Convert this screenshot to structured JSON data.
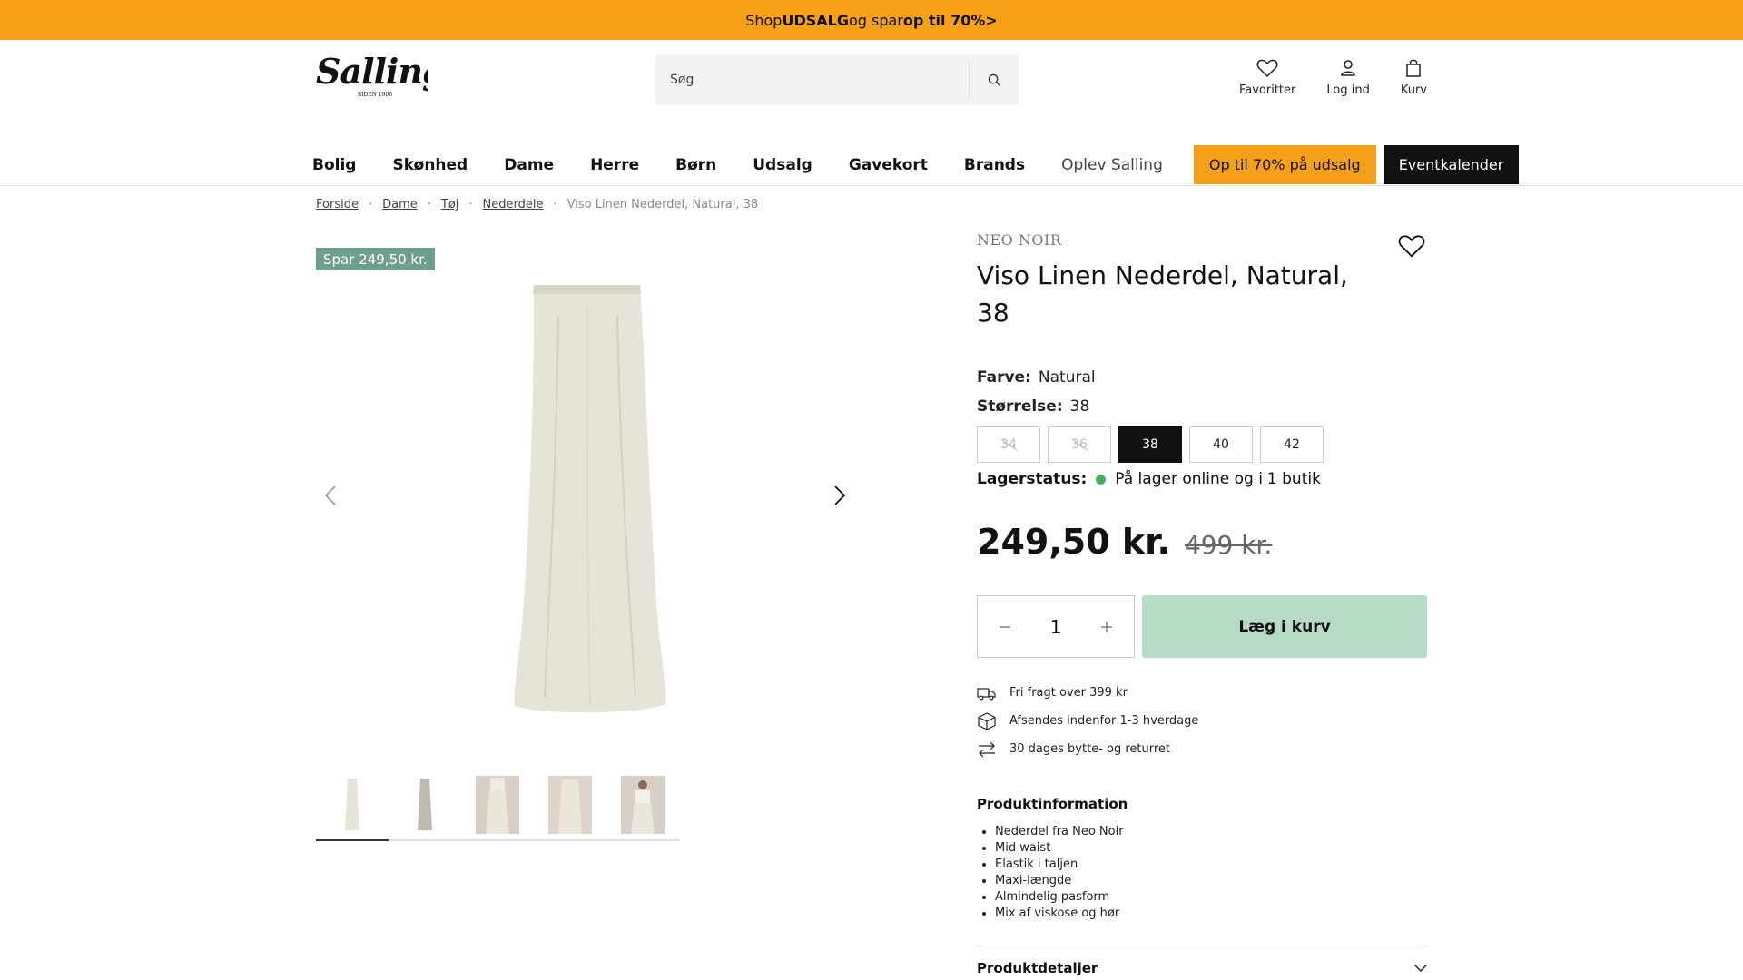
{
  "promo": {
    "pre": "Shop ",
    "b1": "UDSALG",
    "mid": " og spar ",
    "b2": "op til 70%",
    "arrow": " >"
  },
  "logo": {
    "name": "Salling",
    "tagline": "SIDEN 1906"
  },
  "search": {
    "placeholder": "Søg",
    "icon": "search-icon"
  },
  "header": {
    "favorites": "Favoritter",
    "login": "Log ind",
    "cart": "Kurv"
  },
  "nav": {
    "items": [
      "Bolig",
      "Skønhed",
      "Dame",
      "Herre",
      "Børn",
      "Udsalg",
      "Gavekort",
      "Brands"
    ],
    "light": "Oplev Salling",
    "sale_pill": "Op til 70% på udsalg",
    "events_pill": "Eventkalender"
  },
  "breadcrumb": [
    "Forside",
    "Dame",
    "Tøj",
    "Nederdele"
  ],
  "breadcrumb_current": "Viso Linen Nederdel, Natural, 38",
  "badge": "Spar 249,50 kr.",
  "product": {
    "brand": "NEO NOIR",
    "title": "Viso Linen Nederdel, Natural, 38",
    "color_label": "Farve:",
    "color_value": "Natural",
    "size_label": "Størrelse:",
    "size_value": "38",
    "sizes": [
      {
        "label": "34",
        "state": "unavailable"
      },
      {
        "label": "36",
        "state": "unavailable"
      },
      {
        "label": "38",
        "state": "selected"
      },
      {
        "label": "40",
        "state": "available"
      },
      {
        "label": "42",
        "state": "available"
      }
    ],
    "stock_label": "Lagerstatus:",
    "stock_text": "På lager online og i",
    "stock_link": "1 butik",
    "price_now": "249,50 kr.",
    "price_old": "499 kr.",
    "quantity": "1",
    "add_to_cart": "Læg i kurv"
  },
  "perks": [
    "Fri fragt over 399 kr",
    "Afsendes indenfor 1-3 hverdage",
    "30 dages bytte- og returret"
  ],
  "product_info": {
    "heading": "Produktinformation",
    "items": [
      "Nederdel fra Neo Noir",
      "Mid waist",
      "Elastik i taljen",
      "Maxi-længde",
      "Almindelig pasform",
      "Mix af viskose og hør"
    ]
  },
  "details_accordion": "Produktdetaljer",
  "colors": {
    "promo": "#f6a01a",
    "badge": "#6e9e8c",
    "cart_button": "#b7dbc6",
    "in_stock": "#46b05e",
    "skirt": "#e6e3d8"
  }
}
